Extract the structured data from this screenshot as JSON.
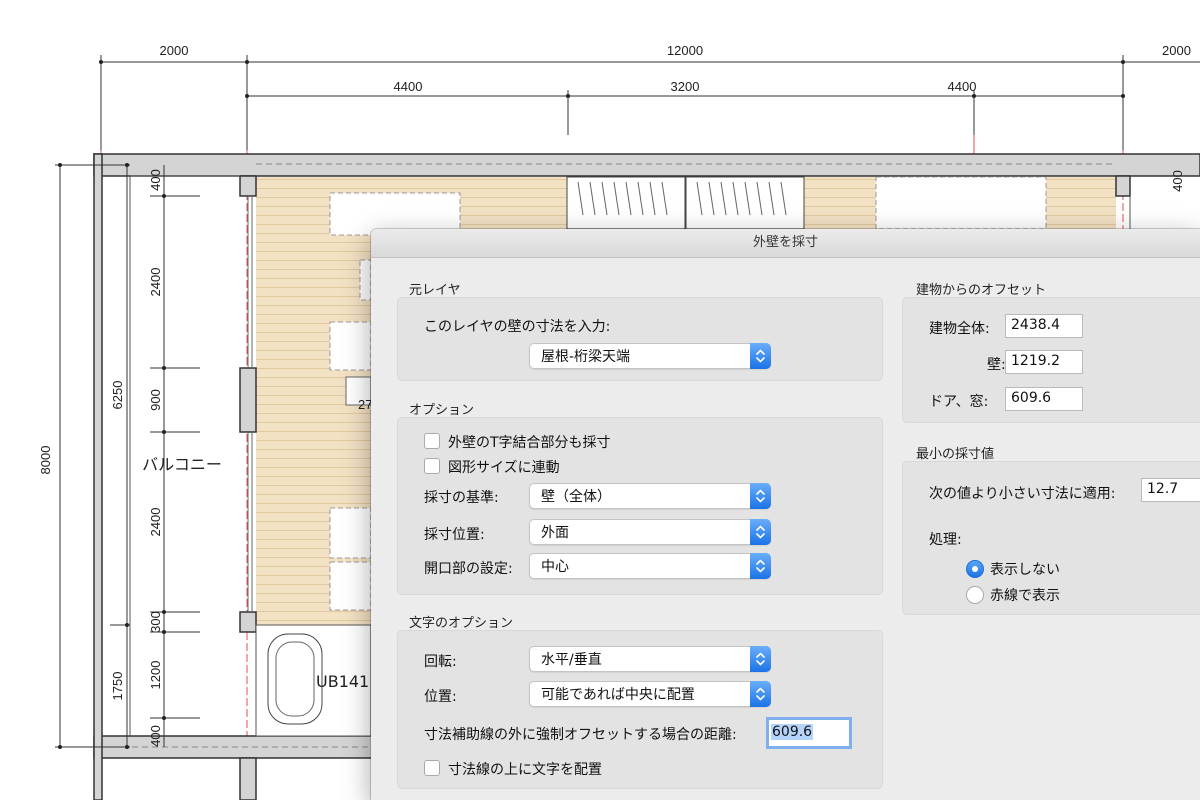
{
  "drawing": {
    "top_dims": [
      "2000",
      "12000",
      "2000"
    ],
    "second_dims": [
      "4400",
      "3200",
      "4400"
    ],
    "left_outer_dim": "8000",
    "left_mid_dims": [
      "6250",
      "1750"
    ],
    "left_inner_dims": [
      "400",
      "2400",
      "900",
      "2400",
      "300",
      "1200",
      "400"
    ],
    "right_inner_dim": "400",
    "room_balcony": "バルコニー",
    "room_bath": "UB141",
    "fragment_label": "27"
  },
  "dialog": {
    "title": "外壁を採寸",
    "source_layer": {
      "section": "元レイヤ",
      "prompt": "このレイヤの壁の寸法を入力:",
      "layer_value": "屋根-桁梁天端"
    },
    "options": {
      "section": "オプション",
      "check_t_joints": "外壁のT字結合部分も採寸",
      "check_link_shape": "図形サイズに連動",
      "basis_label": "採寸の基準:",
      "basis_value": "壁（全体）",
      "position_label": "採寸位置:",
      "position_value": "外面",
      "opening_label": "開口部の設定:",
      "opening_value": "中心"
    },
    "text_options": {
      "section": "文字のオプション",
      "rotation_label": "回転:",
      "rotation_value": "水平/垂直",
      "location_label": "位置:",
      "location_value": "可能であれば中央に配置",
      "force_offset_label": "寸法補助線の外に強制オフセットする場合の距離:",
      "force_offset_value": "609.6",
      "check_text_above": "寸法線の上に文字を配置"
    },
    "offset": {
      "section": "建物からのオフセット",
      "whole_label": "建物全体:",
      "whole_value": "2438.4",
      "wall_label": "壁:",
      "wall_value": "1219.2",
      "door_label": "ドア、窓:",
      "door_value": "609.6"
    },
    "minimum": {
      "section": "最小の採寸値",
      "apply_label": "次の値より小さい寸法に適用:",
      "apply_value": "12.7",
      "process_label": "処理:",
      "radio_hide": "表示しない",
      "radio_red": "赤線で表示"
    }
  }
}
